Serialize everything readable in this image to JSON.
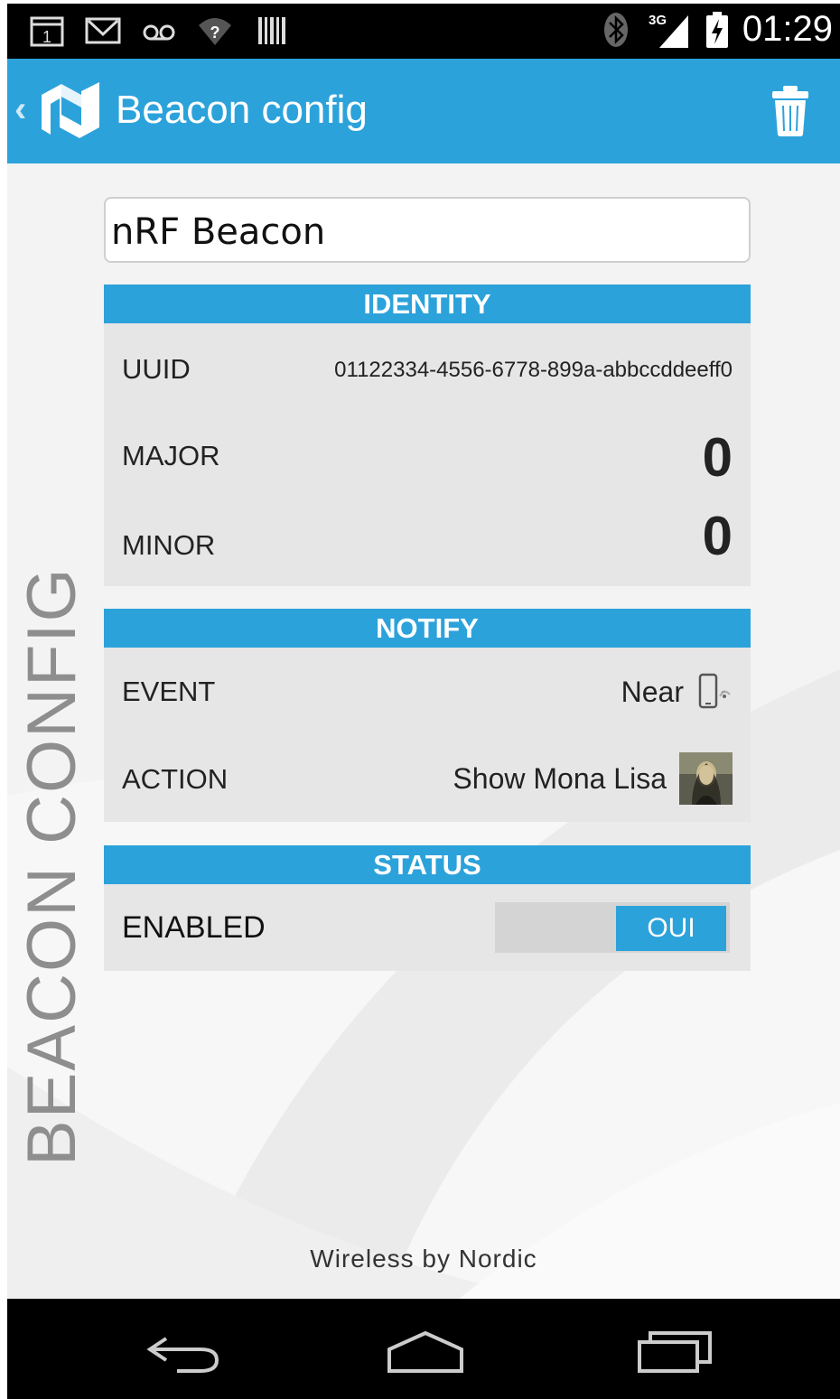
{
  "status_bar": {
    "time": "01:29",
    "network": "3G",
    "left_icons": [
      "calendar-icon",
      "gmail-icon",
      "voicemail-icon",
      "wifi-unknown-icon",
      "barcode-icon"
    ],
    "right_icons": [
      "bluetooth-icon",
      "signal-icon",
      "battery-charging-icon"
    ],
    "calendar_day": "1"
  },
  "action_bar": {
    "title": "Beacon config",
    "back_icon": "chevron-left-icon",
    "logo_icon": "nordic-logo-icon",
    "delete_icon": "trash-icon"
  },
  "side_label": "BEACON CONFIG",
  "beacon_name": "nRF Beacon",
  "identity": {
    "header": "IDENTITY",
    "uuid_label": "UUID",
    "uuid_value": "01122334-4556-6778-899a-abbccddeeff0",
    "major_label": "MAJOR",
    "major_value": "0",
    "minor_label": "MINOR",
    "minor_value": "0"
  },
  "notify": {
    "header": "NOTIFY",
    "event_label": "EVENT",
    "event_value": "Near",
    "event_icon": "phone-near-icon",
    "action_label": "ACTION",
    "action_value": "Show Mona Lisa",
    "action_icon": "mona-lisa-thumbnail"
  },
  "status": {
    "header": "STATUS",
    "enabled_label": "ENABLED",
    "toggle_value": "OUI",
    "toggle_on": true
  },
  "footer": "Wireless by Nordic",
  "nav": {
    "back_icon": "nav-back-icon",
    "home_icon": "nav-home-icon",
    "recents_icon": "nav-recents-icon"
  },
  "colors": {
    "accent": "#2ca2db",
    "panel": "#e6e6e6",
    "background": "#f3f3f3"
  }
}
